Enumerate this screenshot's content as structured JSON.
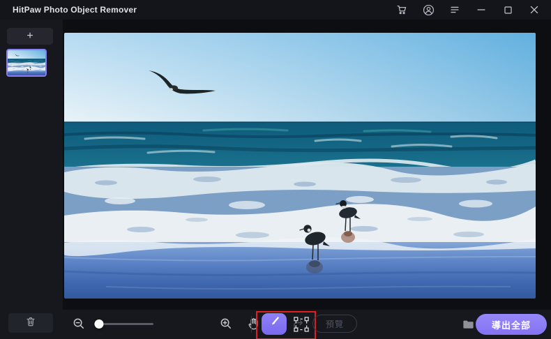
{
  "app": {
    "title": "HitPaw Photo Object Remover"
  },
  "titlebar": {
    "icons": [
      "cart",
      "account",
      "menu",
      "minimize",
      "maximize",
      "close"
    ]
  },
  "sidebar": {
    "add_button_label": "+",
    "thumbnail": {
      "selected": true,
      "border_color": "#8b7cf8"
    }
  },
  "toolbar": {
    "slider": {
      "percent": 8
    },
    "active_tool": "brush",
    "preview_button_label": "預覽",
    "export_button_label": "導出全部",
    "annotation_box_color": "#e11d1d"
  },
  "colors": {
    "accent_purple": "#8b7cf8",
    "titlebar_bg": "#14151b",
    "sidebar_bg": "#17181e",
    "toolbar_bg": "#17181d",
    "canvas_bg": "#0d0e12"
  }
}
